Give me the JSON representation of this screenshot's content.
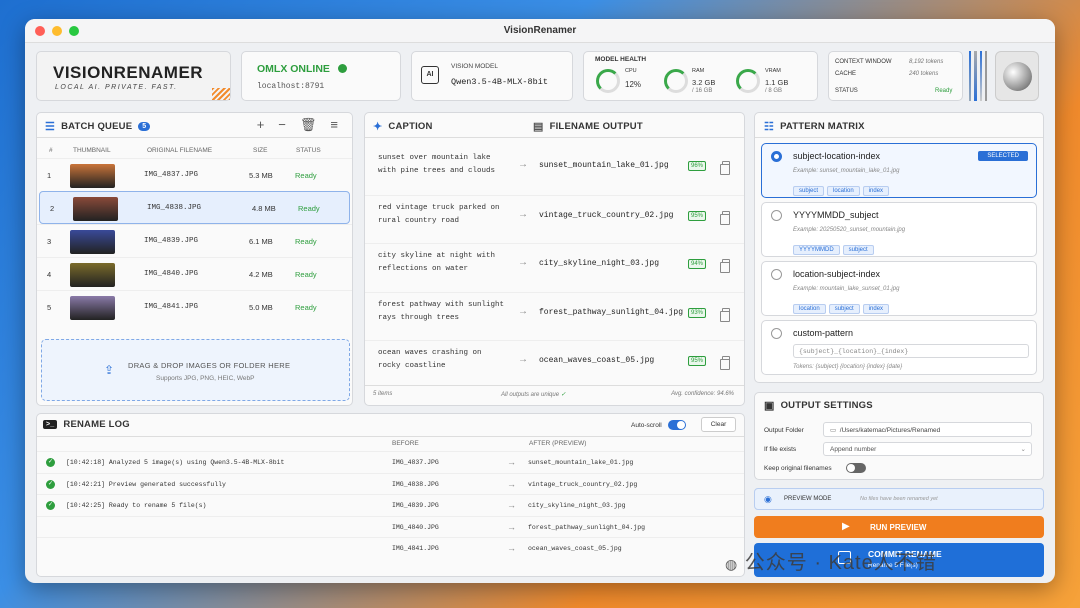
{
  "window": {
    "title": "VisionRenamer"
  },
  "brand": {
    "name": "VISIONRENAMER",
    "tagline": "LOCAL AI. PRIVATE. FAST."
  },
  "server": {
    "status": "OMLX ONLINE",
    "address": "localhost:8791"
  },
  "model": {
    "label": "VISION MODEL",
    "name": "Qwen3.5-4B-MLX-8bit",
    "icon_text": "AI"
  },
  "health": {
    "label": "MODEL HEALTH",
    "cpu_label": "CPU",
    "cpu": "12%",
    "ram_label": "RAM",
    "ram": "3.2 GB",
    "ram_total": "/ 16 GB",
    "vram_label": "VRAM",
    "vram": "1.1 GB",
    "vram_total": "/ 8 GB"
  },
  "context": {
    "window_label": "CONTEXT WINDOW",
    "window_value": "8,192 tokens",
    "cache_label": "CACHE",
    "cache_value": "240 tokens",
    "status_label": "STATUS",
    "status_value": "Ready"
  },
  "queue": {
    "title": "BATCH QUEUE",
    "count": "5",
    "cols": [
      "#",
      "THUMBNAIL",
      "ORIGINAL FILENAME",
      "SIZE",
      "STATUS"
    ],
    "rows": [
      {
        "n": "1",
        "file": "IMG_4837.JPG",
        "size": "5.3 MB",
        "status": "Ready",
        "color": "#c9743a"
      },
      {
        "n": "2",
        "file": "IMG_4838.JPG",
        "size": "4.8 MB",
        "status": "Ready",
        "color": "#8a4a3a"
      },
      {
        "n": "3",
        "file": "IMG_4839.JPG",
        "size": "6.1 MB",
        "status": "Ready",
        "color": "#3a4a9a"
      },
      {
        "n": "4",
        "file": "IMG_4840.JPG",
        "size": "4.2 MB",
        "status": "Ready",
        "color": "#7a6a2a"
      },
      {
        "n": "5",
        "file": "IMG_4841.JPG",
        "size": "5.0 MB",
        "status": "Ready",
        "color": "#8a7aa8"
      }
    ],
    "drop_title": "DRAG & DROP IMAGES OR FOLDER HERE",
    "drop_sub": "Supports JPG, PNG, HEIC, WebP"
  },
  "caption": {
    "title": "CAPTION",
    "output_title": "FILENAME OUTPUT",
    "rows": [
      {
        "cap1": "sunset over mountain lake",
        "cap2": "with pine trees and clouds",
        "out": "sunset_mountain_lake_01.jpg",
        "conf": "96%"
      },
      {
        "cap1": "red vintage truck parked on",
        "cap2": "rural country road",
        "out": "vintage_truck_country_02.jpg",
        "conf": "95%"
      },
      {
        "cap1": "city skyline at night with",
        "cap2": "reflections on water",
        "out": "city_skyline_night_03.jpg",
        "conf": "94%"
      },
      {
        "cap1": "forest pathway with sunlight",
        "cap2": "rays through trees",
        "out": "forest_pathway_sunlight_04.jpg",
        "conf": "93%"
      },
      {
        "cap1": "ocean waves crashing on",
        "cap2": "rocky coastline",
        "out": "ocean_waves_coast_05.jpg",
        "conf": "95%"
      }
    ],
    "footer_items": "5 items",
    "footer_unique": "All outputs are unique",
    "footer_conf": "Avg. confidence: 94.6%"
  },
  "patterns": {
    "title": "PATTERN MATRIX",
    "selected_label": "SELECTED",
    "items": [
      {
        "name": "subject-location-index",
        "example": "Example: sunset_mountain_lake_01.jpg",
        "pills": [
          "subject",
          "location",
          "index"
        ]
      },
      {
        "name": "YYYYMMDD_subject",
        "example": "Example: 20250520_sunset_mountain.jpg",
        "pills": [
          "YYYYMMDD",
          "subject"
        ]
      },
      {
        "name": "location-subject-index",
        "example": "Example: mountain_lake_sunset_01.jpg",
        "pills": [
          "location",
          "subject",
          "index"
        ]
      }
    ],
    "custom": {
      "name": "custom-pattern",
      "value": "{subject}_{location}_{index}",
      "tokens": "Tokens: {subject} {location} {index} {date}"
    }
  },
  "output": {
    "title": "OUTPUT SETTINGS",
    "folder_label": "Output Folder",
    "folder": "/Users/katemac/Pictures/Renamed",
    "exists_label": "If file exists",
    "exists": "Append number",
    "keep_label": "Keep original filenames"
  },
  "preview": {
    "mode": "PREVIEW MODE",
    "note": "No files have been renamed yet",
    "run": "RUN PREVIEW",
    "commit": "COMMIT RENAME",
    "commit_sub": "Rename 5 File(s)"
  },
  "log": {
    "title": "RENAME LOG",
    "autoscroll": "Auto-scroll",
    "clear": "Clear",
    "before": "BEFORE",
    "after": "AFTER (PREVIEW)",
    "rows": [
      {
        "msg": "[10:42:18]  Analyzed 5 image(s) using Qwen3.5-4B-MLX-8bit",
        "before": "IMG_4837.JPG",
        "after": "sunset_mountain_lake_01.jpg"
      },
      {
        "msg": "[10:42:21]  Preview generated successfully",
        "before": "IMG_4838.JPG",
        "after": "vintage_truck_country_02.jpg"
      },
      {
        "msg": "[10:42:25]  Ready to rename 5 file(s)",
        "before": "IMG_4839.JPG",
        "after": "city_skyline_night_03.jpg"
      },
      {
        "msg": "",
        "before": "IMG_4840.JPG",
        "after": "forest_pathway_sunlight_04.jpg"
      },
      {
        "msg": "",
        "before": "IMG_4841.JPG",
        "after": "ocean_waves_coast_05.jpg"
      }
    ]
  },
  "watermark": "公众号 · Kate人不错"
}
